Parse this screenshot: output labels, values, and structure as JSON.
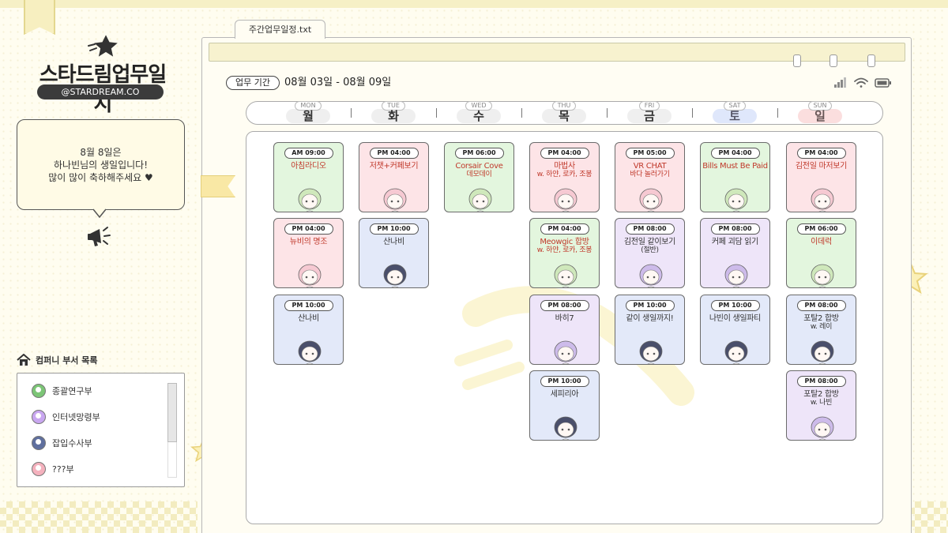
{
  "brand": {
    "title": "스타드림업무일지",
    "handle": "@STARDREAM.CO"
  },
  "notice": {
    "lines": [
      "8월 8일은",
      "하나빈님의 생일입니다!",
      "많이 많이 축하해주세요 ♥"
    ]
  },
  "departments": {
    "heading": "컴퍼니 부서 목록",
    "items": [
      {
        "label": "종괄연구부",
        "color": "#7cc576"
      },
      {
        "label": "인터넷망령부",
        "color": "#c9a7f0"
      },
      {
        "label": "잡입수사부",
        "color": "#5f6f9e"
      },
      {
        "label": "???부",
        "color": "#f4b1bd"
      }
    ]
  },
  "window": {
    "tab_label": "주간업무일정.txt"
  },
  "period": {
    "label": "업무 기간",
    "value": "08월 03일 - 08월 09일"
  },
  "days": [
    {
      "en": "MON",
      "ko": "월"
    },
    {
      "en": "TUE",
      "ko": "화"
    },
    {
      "en": "WED",
      "ko": "수"
    },
    {
      "en": "THU",
      "ko": "목"
    },
    {
      "en": "FRI",
      "ko": "금"
    },
    {
      "en": "SAT",
      "ko": "토"
    },
    {
      "en": "SUN",
      "ko": "일"
    }
  ],
  "schedule": [
    [
      {
        "time": "AM 09:00",
        "title": "아침라디오",
        "sub": "",
        "color": "green"
      },
      {
        "time": "PM 04:00",
        "title": "뉴비의 명조",
        "sub": "",
        "color": "pink"
      },
      {
        "time": "PM 10:00",
        "title": "산나비",
        "sub": "",
        "color": "blue"
      }
    ],
    [
      {
        "time": "PM 04:00",
        "title": "저챗+커페보기",
        "sub": "",
        "color": "pink"
      },
      {
        "time": "PM 10:00",
        "title": "산나비",
        "sub": "",
        "color": "blue"
      }
    ],
    [
      {
        "time": "PM 06:00",
        "title": "Corsair Cove",
        "sub": "데모데이",
        "color": "green"
      }
    ],
    [
      {
        "time": "PM 04:00",
        "title": "마법사",
        "sub": "w. 하얀, 로카, 조봉",
        "color": "pink"
      },
      {
        "time": "PM 04:00",
        "title": "Meowgic 합방",
        "sub": "w. 하얀, 로카, 조봉",
        "color": "green"
      },
      {
        "time": "PM 08:00",
        "title": "바히7",
        "sub": "",
        "color": "purple"
      },
      {
        "time": "PM 10:00",
        "title": "세피리아",
        "sub": "",
        "color": "blue"
      }
    ],
    [
      {
        "time": "PM 05:00",
        "title": "VR CHAT",
        "sub": "바다 놀러가기",
        "color": "pink"
      },
      {
        "time": "PM 08:00",
        "title": "김전일 같이보기",
        "sub": "(절반)",
        "color": "purple"
      },
      {
        "time": "PM 10:00",
        "title": "같이 생일까지!",
        "sub": "",
        "color": "blue"
      }
    ],
    [
      {
        "time": "PM 04:00",
        "title": "Bills Must Be Paid",
        "sub": "",
        "color": "green"
      },
      {
        "time": "PM 08:00",
        "title": "커페 괴담 읽기",
        "sub": "",
        "color": "purple"
      },
      {
        "time": "PM 10:00",
        "title": "나빈이 생일파티",
        "sub": "",
        "color": "blue"
      }
    ],
    [
      {
        "time": "PM 04:00",
        "title": "김전일 마저보기",
        "sub": "",
        "color": "pink"
      },
      {
        "time": "PM 06:00",
        "title": "이데럭",
        "sub": "",
        "color": "green"
      },
      {
        "time": "PM 08:00",
        "title": "포탈2 합방",
        "sub": "w. 레이",
        "color": "blue"
      },
      {
        "time": "PM 08:00",
        "title": "포탈2 합방",
        "sub": "w. 나빈",
        "color": "purple"
      }
    ]
  ],
  "colors": {
    "green": "#e3f6de",
    "pink": "#fde4e7",
    "blue": "#e3e9f9",
    "purple": "#eee5f9",
    "hair_green": "#cfe8bb",
    "hair_pink": "#f6c9d2",
    "hair_dark": "#4a4f6b",
    "hair_purple": "#cdbbea"
  }
}
